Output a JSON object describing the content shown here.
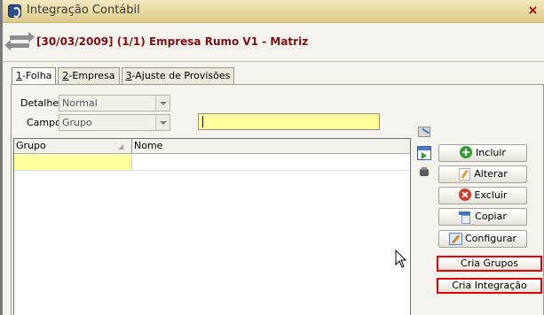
{
  "window": {
    "title": "Integração Contábil",
    "close_label": "×"
  },
  "header": {
    "info": "[30/03/2009] (1/1) Empresa Rumo V1 - Matriz"
  },
  "tabs": [
    {
      "key": "1",
      "label": "-Folha",
      "active": true
    },
    {
      "key": "2",
      "label": "-Empresa",
      "active": false
    },
    {
      "key": "3",
      "label": "-Ajuste de Provisões",
      "active": false
    }
  ],
  "filters": {
    "detalhe_label": "Detalhe",
    "detalhe_value": "Normal",
    "campo_label": "Campo",
    "campo_value": "Grupo",
    "search_value": ""
  },
  "grid": {
    "columns": [
      "Grupo",
      "Nome"
    ]
  },
  "actions": {
    "incluir": "Incluir",
    "alterar": "Alterar",
    "excluir": "Excluir",
    "copiar": "Copiar",
    "configurar": "Configurar",
    "cria_grupos": "Cria Grupos",
    "cria_integracao": "Cria Integração"
  }
}
